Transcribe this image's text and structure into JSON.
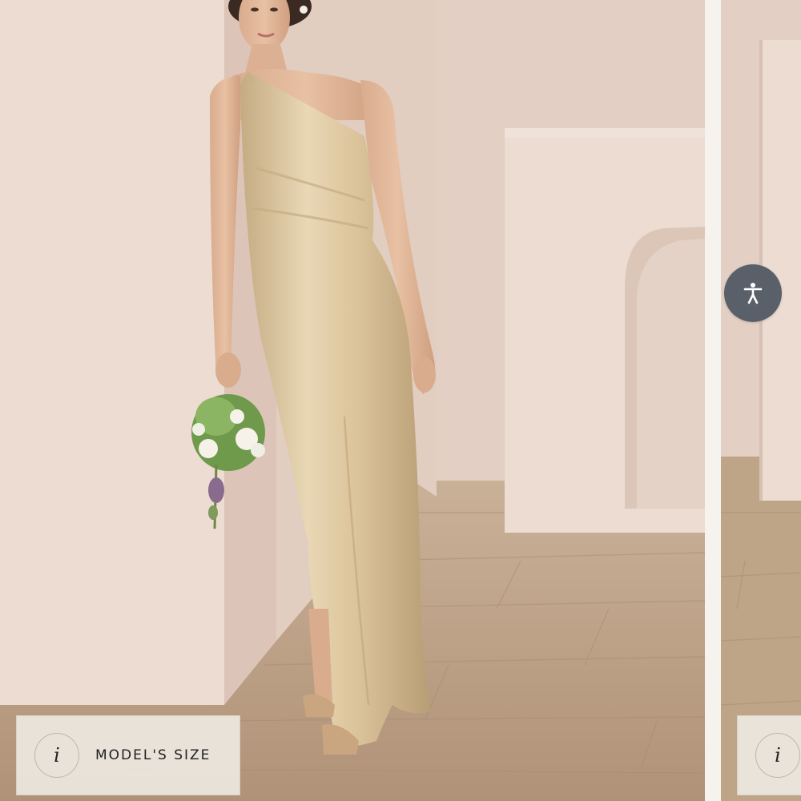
{
  "gallery": {
    "main_slide": {
      "alt": "Model wearing champagne satin one-shoulder maxi dress holding a bouquet",
      "size_button": {
        "icon": "info-icon",
        "icon_glyph": "i",
        "label": "MODEL'S SIZE"
      }
    },
    "next_slide": {
      "size_button": {
        "icon": "info-icon",
        "icon_glyph": "i"
      }
    }
  },
  "accessibility": {
    "icon": "accessibility-person-icon"
  },
  "colors": {
    "wall": "#e6d3c8",
    "floor": "#b99f83",
    "dress": "#d8c29c",
    "accessibility_button": "#5a6069",
    "size_button_bg": "#ece7e0"
  }
}
